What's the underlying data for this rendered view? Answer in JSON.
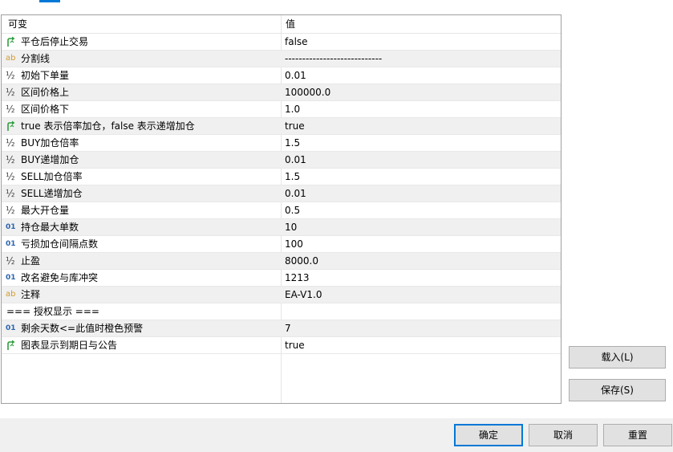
{
  "grid": {
    "header": {
      "name": "可变",
      "value": "值"
    },
    "rows": [
      {
        "icon": "arrow-toggle",
        "name": "平仓后停止交易",
        "value": "false"
      },
      {
        "icon": "ab",
        "name": "分割线",
        "value": "----------------------------"
      },
      {
        "icon": "half",
        "name": "初始下单量",
        "value": "0.01"
      },
      {
        "icon": "half",
        "name": "区间价格上",
        "value": "100000.0"
      },
      {
        "icon": "half",
        "name": "区间价格下",
        "value": "1.0"
      },
      {
        "icon": "arrow-toggle",
        "name": "true 表示倍率加仓，false 表示递增加仓",
        "value": "true"
      },
      {
        "icon": "half",
        "name": "BUY加仓倍率",
        "value": "1.5"
      },
      {
        "icon": "half",
        "name": "BUY递增加仓",
        "value": "0.01"
      },
      {
        "icon": "half",
        "name": "SELL加仓倍率",
        "value": "1.5"
      },
      {
        "icon": "half",
        "name": "SELL递增加仓",
        "value": "0.01"
      },
      {
        "icon": "half",
        "name": "最大开仓量",
        "value": "0.5"
      },
      {
        "icon": "01",
        "name": "持仓最大单数",
        "value": "10"
      },
      {
        "icon": "01",
        "name": "亏损加仓间隔点数",
        "value": "100"
      },
      {
        "icon": "half",
        "name": "止盈",
        "value": "8000.0"
      },
      {
        "icon": "01",
        "name": "改名避免与库冲突",
        "value": "1213"
      },
      {
        "icon": "ab",
        "name": "注释",
        "value": "EA-V1.0"
      },
      {
        "icon": "none",
        "name": "=== 授权显示 ===",
        "value": ""
      },
      {
        "icon": "01",
        "name": "剩余天数<=此值时橙色预警",
        "value": "7"
      },
      {
        "icon": "arrow-toggle",
        "name": "图表显示到期日与公告",
        "value": "true"
      }
    ]
  },
  "side_buttons": {
    "load": "载入(L)",
    "save": "保存(S)"
  },
  "bottom_buttons": {
    "ok": "确定",
    "cancel": "取消",
    "reset": "重置"
  },
  "colors": {
    "accent": "#0078d7",
    "arrow_icon": "#2e9e3e",
    "ab_icon": "#d49a2a",
    "int_icon": "#2a64b0"
  }
}
